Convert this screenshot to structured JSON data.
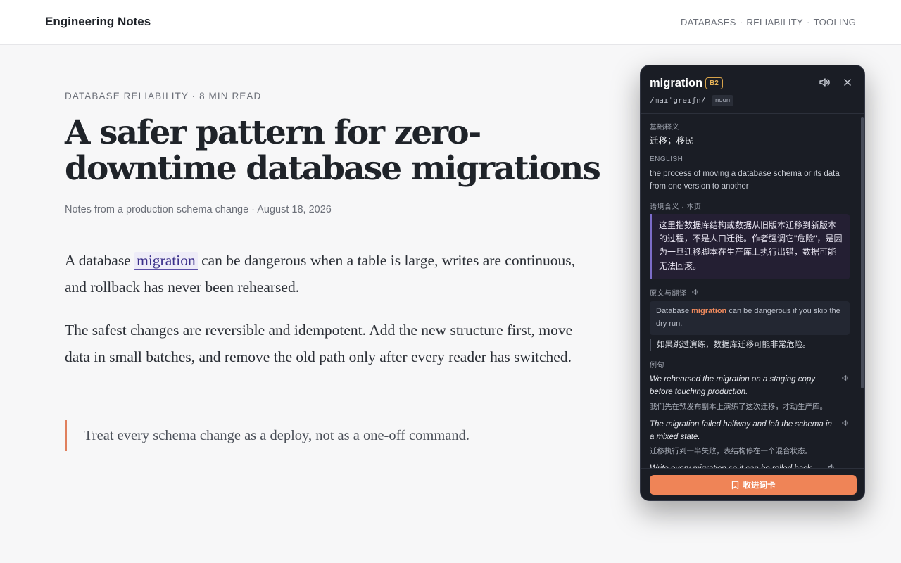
{
  "site": {
    "brand": "Engineering Notes",
    "nav": [
      "DATABASES",
      "RELIABILITY",
      "TOOLING"
    ],
    "nav_sep": "·"
  },
  "article": {
    "kicker": "DATABASE RELIABILITY · 8 MIN READ",
    "title": "A safer pattern for zero-downtime database migrations",
    "meta": "Notes from a production schema change · August 18, 2026",
    "p1_before": "A database ",
    "p1_word": "migration",
    "p1_after": " can be dangerous when a table is large, writes are continuous, and rollback has never been rehearsed.",
    "p2": "The safest changes are reversible and idempotent. Add the new structure first, move data in small batches, and remove the old path only after every reader has switched.",
    "quote": "Treat every schema change as a deploy, not as a one-off command."
  },
  "popup": {
    "word": "migration",
    "level": "B2",
    "phonetic": "/maɪˈɡreɪʃn/",
    "pos": "noun",
    "basic_label": "基础释义",
    "basic": "迁移；移民",
    "english_label": "ENGLISH",
    "english": "the process of moving a database schema or its data from one version to another",
    "context_label": "语境含义 · 本页",
    "context": "这里指数据库结构或数据从旧版本迁移到新版本的过程，不是人口迁徙。作者强调它\"危险\"，是因为一旦迁移脚本在生产库上执行出错，数据可能无法回滚。",
    "source_label": "原文与翻译",
    "source_before": "Database ",
    "source_word": "migration",
    "source_after": " can be dangerous if you skip the dry run.",
    "source_translation": "如果跳过演练，数据库迁移可能非常危险。",
    "examples_label": "例句",
    "examples": [
      {
        "en": "We rehearsed the migration on a staging copy before touching production.",
        "zh": "我们先在预发布副本上演练了这次迁移，才动生产库。"
      },
      {
        "en": "The migration failed halfway and left the schema in a mixed state.",
        "zh": "迁移执行到一半失败，表结构停在一个混合状态。"
      },
      {
        "en": "Write every migration so it can be rolled back.",
        "zh": ""
      }
    ],
    "save_label": "收进词卡"
  },
  "colors": {
    "accent": "#ef8457",
    "highlight": "#5b4fa8",
    "popup_bg": "#1a1d25",
    "level_badge": "#e9b458"
  },
  "icons": [
    "speaker-icon",
    "close-icon",
    "bookmark-icon"
  ]
}
